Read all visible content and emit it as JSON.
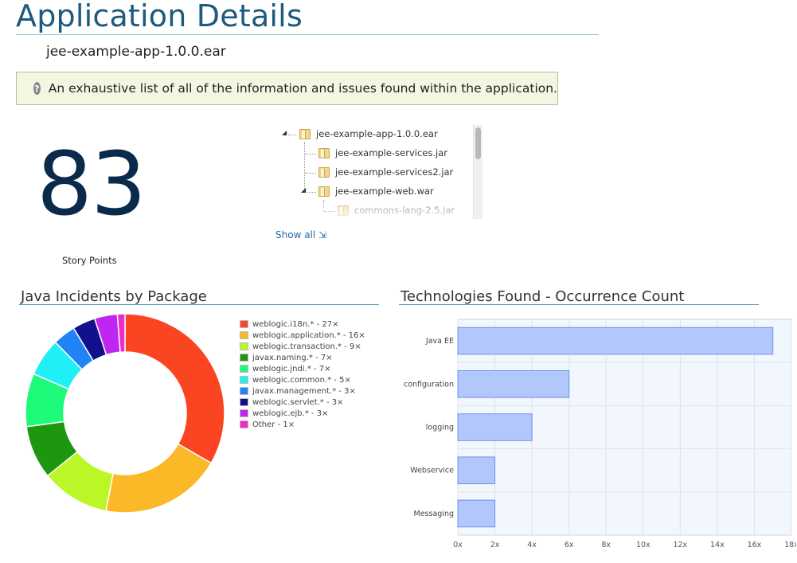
{
  "header": {
    "title": "Application Details",
    "app_name": "jee-example-app-1.0.0.ear",
    "info_text": "An exhaustive list of all of the information and issues found within the application.",
    "info_icon": "question-icon"
  },
  "story_points": {
    "value": "83",
    "label": "Story Points"
  },
  "tree": {
    "items": [
      {
        "label": "jee-example-app-1.0.0.ear"
      },
      {
        "label": "jee-example-services.jar"
      },
      {
        "label": "jee-example-services2.jar"
      },
      {
        "label": "jee-example-web.war"
      },
      {
        "label": "commons-lang-2.5.jar"
      }
    ],
    "show_all": "Show all ⇲"
  },
  "incidents_section": {
    "title": "Java Incidents by Package"
  },
  "technologies_section": {
    "title": "Technologies Found - Occurrence Count"
  },
  "chart_data": [
    {
      "type": "pie",
      "title": "Java Incidents by Package",
      "donut": true,
      "legend_position": "right",
      "slices": [
        {
          "label": "weblogic.i18n.* - 27×",
          "value": 27,
          "color": "#fb4422"
        },
        {
          "label": "weblogic.application.* - 16×",
          "value": 16,
          "color": "#fbb927"
        },
        {
          "label": "weblogic.transaction.* - 9×",
          "value": 9,
          "color": "#bbf627"
        },
        {
          "label": "javax.naming.* - 7×",
          "value": 7,
          "color": "#1e9610"
        },
        {
          "label": "weblogic.jndi.* - 7×",
          "value": 7,
          "color": "#1efa7a"
        },
        {
          "label": "weblogic.common.* - 5×",
          "value": 5,
          "color": "#1ef0f6"
        },
        {
          "label": "javax.management.* - 3×",
          "value": 3,
          "color": "#2184f5"
        },
        {
          "label": "weblogic.servlet.* - 3×",
          "value": 3,
          "color": "#12108c"
        },
        {
          "label": "weblogic.ejb.* - 3×",
          "value": 3,
          "color": "#bf26f1"
        },
        {
          "label": "Other - 1×",
          "value": 1,
          "color": "#f02ac8"
        }
      ]
    },
    {
      "type": "bar",
      "orientation": "horizontal",
      "title": "Technologies Found - Occurrence Count",
      "categories": [
        "Java EE",
        "configuration",
        "logging",
        "Webservice",
        "Messaging"
      ],
      "values": [
        17,
        6,
        4,
        2,
        2
      ],
      "xlim": [
        0,
        18
      ],
      "xticks": [
        "0x",
        "2x",
        "4x",
        "6x",
        "8x",
        "10x",
        "12x",
        "14x",
        "16x",
        "18x"
      ],
      "grid": true,
      "bar_color": "#b3c8fa",
      "bar_border": "#6d8ff0",
      "plot_background": "#f2f6fd"
    }
  ]
}
